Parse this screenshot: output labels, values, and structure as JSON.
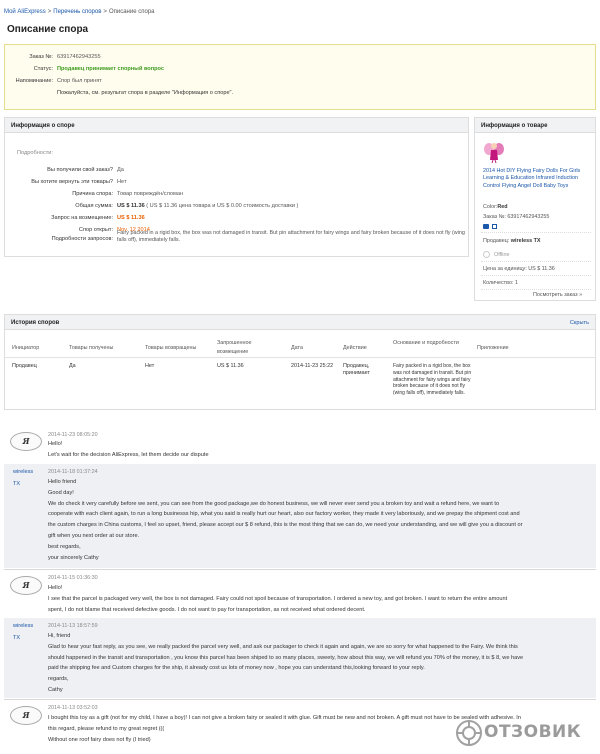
{
  "breadcrumb": {
    "items": [
      "Мой AliExpress",
      "Перечень споров",
      "Описание спора"
    ],
    "separator": ">"
  },
  "page_title": "Описание спора",
  "summary": {
    "order_label": "Заказ №:",
    "order_value": "63917462943255",
    "status_label": "Статус:",
    "status_value": "Продавец принимает спорный вопрос",
    "reminder_label": "Напоминание:",
    "reminder_line1": "Спор был принят",
    "reminder_line2": "Пожалуйста, см. результат спора в разделе \"Информация о споре\"."
  },
  "dispute_info": {
    "header": "Информация о споре",
    "details_label": "Подробности:",
    "fields": [
      {
        "label": "Вы получили свой заказ?",
        "value": "Да"
      },
      {
        "label": "Вы хотите вернуть эти товары?",
        "value": "Нет"
      },
      {
        "label": "Причина спора:",
        "value": "Товар повреждён/сломан"
      },
      {
        "label": "Общая сумма:",
        "value_main": "US $ 11.36",
        "value_rest": "( US $ 11.36 цена товара и US $ 0.00 стоимость доставки )"
      },
      {
        "label": "Запрос на возмещение:",
        "value": "US $ 11.36"
      },
      {
        "label": "Спор открыт:",
        "value": "Nov. 12 2014"
      },
      {
        "label": "Подробности запросов:",
        "value": "Fairy packed in a rigid box, the box was not damaged in transit. But pin attachment for fairy wings and fairy broken because of it does not fly (wing falls off), immediately falls."
      }
    ]
  },
  "product_info": {
    "header": "Информация о товаре",
    "title": "2014 Hot DIY Flying Fairy Dolls For Girls Learning & Education Infrared Induction Control Flying Angel Doll Baby Toys",
    "color_label": "Color:",
    "color_value": "Red",
    "order_label": "Заказ №:",
    "order_value": "63917462943255",
    "seller_label": "Продавец:",
    "seller_name": "wireless TX",
    "offline": "Offline",
    "unit_price": "Цена за единицу: US $ 11.36",
    "quantity": "Количество: 1",
    "view_order": "Посмотреть заказ »"
  },
  "history": {
    "header": "История споров",
    "hide_link": "Скрыть",
    "columns": [
      "Инициатор",
      "Товары получены",
      "Товары возвращены",
      "Запрошенное возмещение",
      "Дата",
      "Действие",
      "Основание и подробности",
      "Приложение"
    ],
    "row": {
      "initiator": "Продавец",
      "received": "Да",
      "returned": "Нет",
      "refund": "US $ 11.36",
      "date": "2014-11-23 25:22",
      "action": "Продавец, принимает",
      "reason": "Fairy packed in a rigid box, the box was not damaged in transit. But pin attachment for fairy wings and fairy broken because of it does not fly (wing falls off), immediately falls.",
      "attachment": ""
    }
  },
  "messages": [
    {
      "author": "Я",
      "time": "2014-11-23 08:05:20",
      "lines": [
        "Hello!",
        "Let's wait for the decision AliExpress, let them decide our dispute"
      ]
    },
    {
      "author_line1": "wireless",
      "author_line2": "TX",
      "time": "2014-11-18 01:37:24",
      "lines": [
        "Hello friend",
        "Good day!",
        "We do check it very carefully before we sent,  you can see from the good package,we do honest business, we will never ever  send you a broken toy and wait a refund here, we want to",
        "cooperate with each client again, to run a long businesss hip, what you said is really hurt our heart, also our factory worker, they made it very laboriously, and we prepay the shipment cost and",
        "the custom charges in China customs, I feel so upset, friend, please accept our $ 8 refund, this is the most thing that we can do, we need your understanding, and we will give you a discount or",
        "gift when you next order at our store.",
        "best regards,",
        "your sincerely Cathy"
      ]
    },
    {
      "author": "Я",
      "time": "2014-11-15 01:36:30",
      "lines": [
        "Hello!",
        "I see that the parcel is packaged very well, the box is not damaged. Fairy could not spoil because of transportation. I ordered a new toy, and got broken. I want to return the entire amount",
        "spent, I do not blame that received defective goods. I do not want to pay for transportation, as not received what ordered decent."
      ]
    },
    {
      "author_line1": "wireless",
      "author_line2": "TX",
      "time": "2014-11-13 18:57:59",
      "lines": [
        "Hi, friend",
        "Glad to hear your fast reply, as you see, we really packed the parcel very well, and ask our packager to check it again and again, we are so sorry for what happened to the Fairy.  We think this",
        "should happened in the transit and transportation , you know this parcel has been shiped to so many places, sweety, how about this way, we will refund  you 70% of the money, it is $ 8, we have",
        "paid the shipping fee and Custom charges for the ship, it already cost us lots of money now , hope you can understand this,looking forward to your reply.",
        "regards,",
        "Cathy"
      ]
    },
    {
      "author": "Я",
      "time": "2014-11-13 03:52:03",
      "lines": [
        "I bought this toy as a gift (not for my child, I have a boy)! I can not give a broken fairy or sealed it with glue. Gift must be new and not broken. A gift must not have to be sealed with adhesive. In",
        "this regard, please refund to my great regret (((",
        "Without one roof fairy does not fly (I tried)"
      ]
    }
  ],
  "watermark": "ОТЗОВИК",
  "colors": {
    "link": "#1a57a8",
    "status_green": "#3e9b1f",
    "amount_orange": "#e86000",
    "seller_bg": "#eef0f3"
  }
}
